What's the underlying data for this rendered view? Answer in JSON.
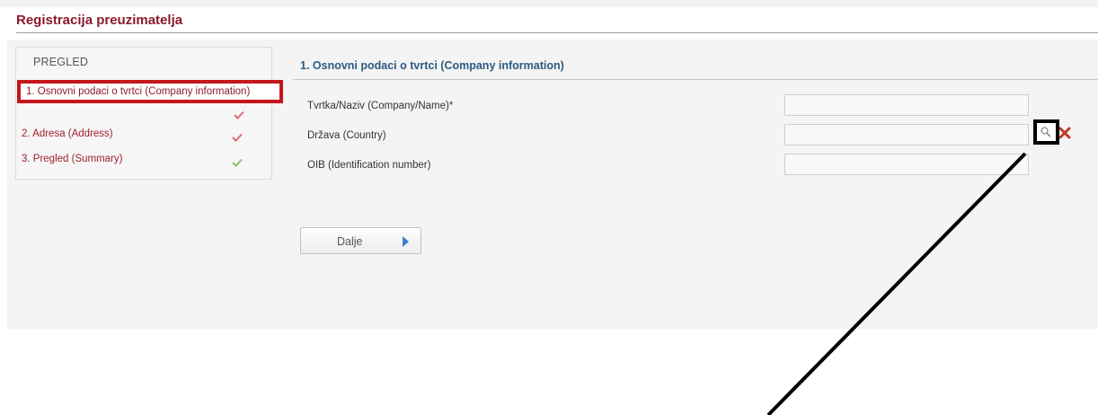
{
  "page": {
    "title": "Registracija preuzimatelja"
  },
  "sidebar": {
    "header": "PREGLED",
    "items": [
      {
        "label": "1. Osnovni podaci o tvrtci (Company information)",
        "status": "incomplete",
        "check_color": "#e06a78",
        "active": true
      },
      {
        "label": "2. Adresa (Address)",
        "status": "incomplete",
        "check_color": "#e06a78"
      },
      {
        "label": "3. Pregled (Summary)",
        "status": "complete",
        "check_color": "#8dbf6a"
      }
    ]
  },
  "form": {
    "section_title": "1. Osnovni podaci o tvrtci (Company information)",
    "fields": [
      {
        "label": "Tvrtka/Naziv (Company/Name)*",
        "value": ""
      },
      {
        "label": "Država (Country)",
        "value": "",
        "icons": [
          "search-icon",
          "clear-icon"
        ]
      },
      {
        "label": "OIB (Identification number)",
        "value": ""
      }
    ],
    "next_button": {
      "label": "Dalje",
      "icon": "arrow-right-icon"
    }
  },
  "colors": {
    "title": "#8b1a2b",
    "section_title": "#2d5a80",
    "highlight_red": "#c4161c",
    "highlight_black": "#000000",
    "clear_icon": "#c0392b",
    "arrow_blue": "#3d7fcf"
  }
}
